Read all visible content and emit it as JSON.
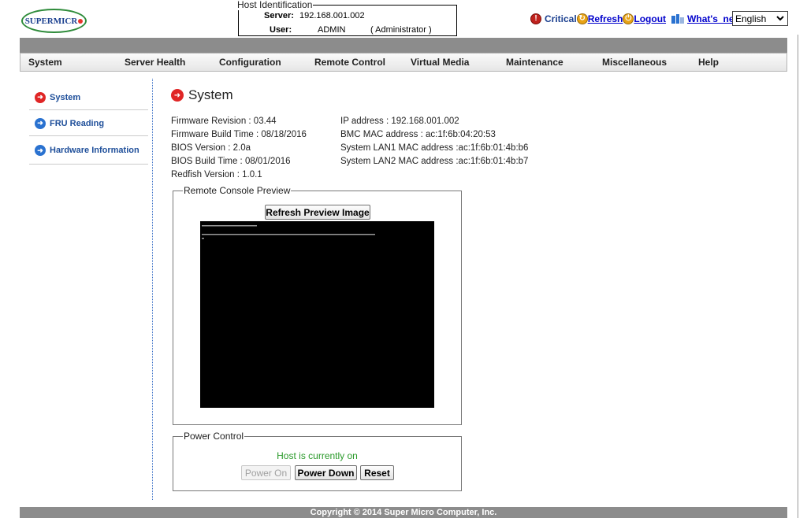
{
  "logo": {
    "text": "SUPERMICR"
  },
  "host_identification": {
    "legend": "Host Identification",
    "server_label": "Server:",
    "server_value": "192.168.001.002",
    "user_label": "User:",
    "user_value": "ADMIN",
    "user_role": "( Administrator )"
  },
  "top_links": {
    "critical": "Critical",
    "refresh": "Refresh",
    "logout": "Logout",
    "whats_new": "What's_new"
  },
  "language": {
    "selected": "English"
  },
  "nav": [
    "System",
    "Server Health",
    "Configuration",
    "Remote Control",
    "Virtual Media",
    "Maintenance",
    "Miscellaneous",
    "Help"
  ],
  "sidebar": {
    "items": [
      {
        "label": "System"
      },
      {
        "label": "FRU Reading"
      },
      {
        "label": "Hardware Information"
      }
    ]
  },
  "main": {
    "title": "System",
    "left_info": [
      "Firmware Revision : 03.44",
      "Firmware Build Time : 08/18/2016",
      "BIOS Version : 2.0a",
      "BIOS Build Time : 08/01/2016",
      "Redfish Version : 1.0.1"
    ],
    "right_info": [
      "IP address : 192.168.001.002",
      "BMC MAC address : ac:1f:6b:04:20:53",
      "System LAN1 MAC address :ac:1f:6b:01:4b:b6",
      "System LAN2 MAC address :ac:1f:6b:01:4b:b7"
    ],
    "console": {
      "legend": "Remote Console Preview",
      "refresh_button": "Refresh Preview Image"
    },
    "power": {
      "legend": "Power Control",
      "status": "Host is currently on",
      "status_color": "#2a9a2a",
      "power_on": "Power On",
      "power_down": "Power Down",
      "reset": "Reset"
    }
  },
  "footer": {
    "text": "Copyright © 2014 Super Micro Computer, Inc."
  }
}
